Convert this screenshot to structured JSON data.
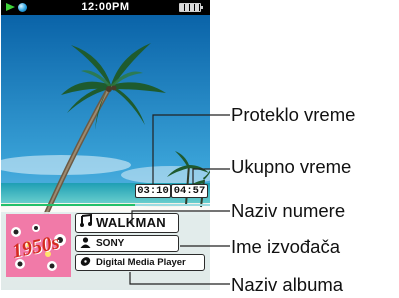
{
  "status_bar": {
    "time": "12:00PM",
    "icons": [
      "play-icon",
      "status-dot-icon",
      "battery-icon"
    ]
  },
  "player": {
    "elapsed_time": "03:10",
    "total_time": "04:57",
    "progress_fraction": 0.64,
    "track_title": "WALKMAN",
    "artist": "SONY",
    "album": "Digital Media Player",
    "album_art_text": "1950s"
  },
  "callouts": {
    "elapsed": "Proteklo vreme",
    "total": "Ukupno vreme",
    "title": "Naziv numere",
    "artist": "Ime izvođača",
    "album": "Naziv albuma"
  },
  "colors": {
    "status_bar": "#000000",
    "play_green": "#3fd13a",
    "progress": "#22c06a",
    "album_art_pink": "#f17aa8",
    "album_art_text": "#d42b1f"
  }
}
